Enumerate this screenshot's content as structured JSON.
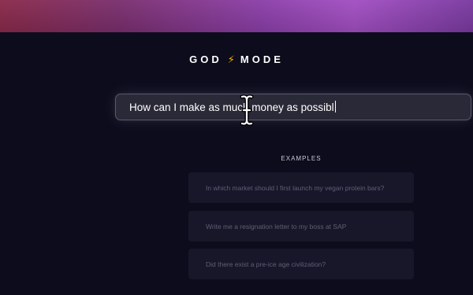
{
  "brand": {
    "left_word": "GOD",
    "bolt_icon": "lightning-bolt-icon",
    "bolt_glyph": "⚡",
    "right_word": "MODE"
  },
  "prompt": {
    "value": "How can I make as much money as possibl"
  },
  "examples": {
    "heading": "EXAMPLES",
    "items": [
      {
        "label": "In which market should I first launch my vegan protein bars?"
      },
      {
        "label": "Write me a resignation letter to my boss at SAP"
      },
      {
        "label": "Did there exist a pre-ice age civilization?"
      }
    ]
  },
  "colors": {
    "background": "#0d0c1d",
    "banner_start": "#8a2a4a",
    "banner_end": "#a24fc2",
    "input_background": "#2a2937",
    "card_background": "#18172a",
    "bolt": "#f5b400"
  }
}
